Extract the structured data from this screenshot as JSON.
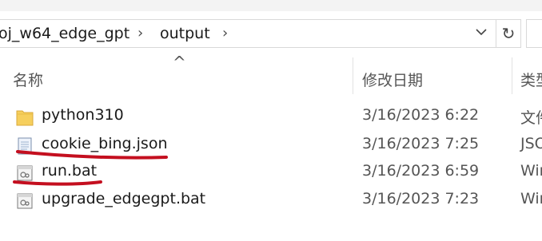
{
  "address": {
    "crumbs": [
      "oj_w64_edge_gpt",
      "output"
    ],
    "separator": "›",
    "dropdown_glyph": "⌄",
    "refresh_glyph": "↻"
  },
  "columns": {
    "name": "名称",
    "date": "修改日期",
    "type": "类型",
    "sort_glyph": "^"
  },
  "files": [
    {
      "name": "python310",
      "date": "3/16/2023 6:22",
      "type": "文件",
      "icon": "folder-icon"
    },
    {
      "name": "cookie_bing.json",
      "date": "3/16/2023 7:25",
      "type": "JSO",
      "icon": "json-file-icon"
    },
    {
      "name": "run.bat",
      "date": "3/16/2023 6:59",
      "type": "Win",
      "icon": "bat-file-icon"
    },
    {
      "name": "upgrade_edgegpt.bat",
      "date": "3/16/2023 7:23",
      "type": "Win",
      "icon": "bat-file-icon"
    }
  ],
  "colors": {
    "folder": "#f6cf5d",
    "annotation": "#c40f1f"
  }
}
